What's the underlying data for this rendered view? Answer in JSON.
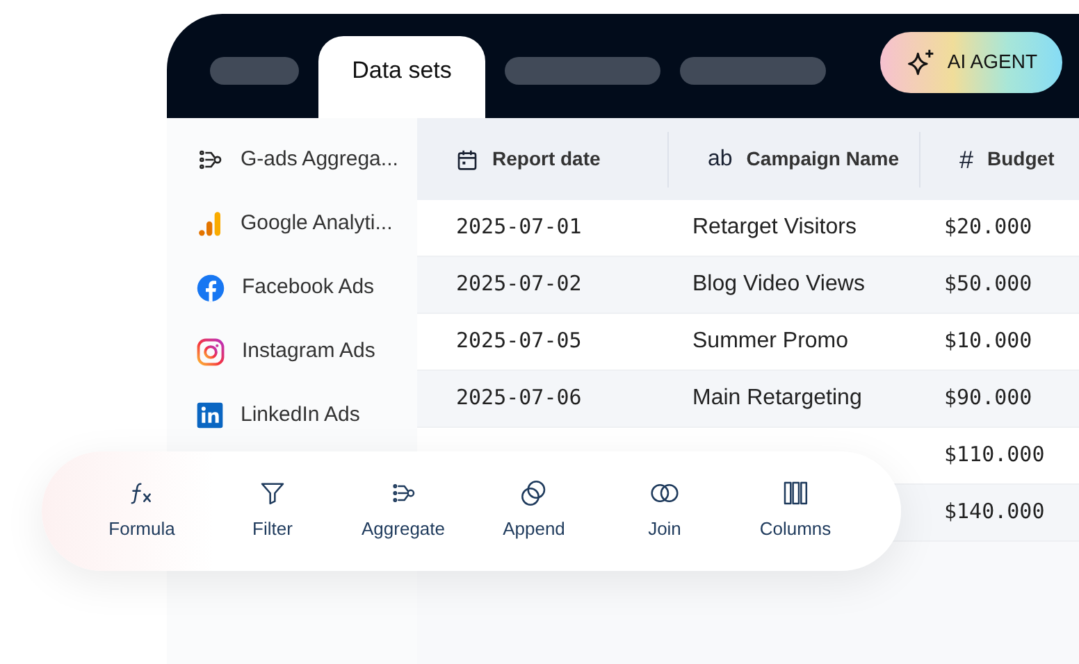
{
  "tabs": [
    {
      "selected": false
    },
    {
      "label": "Data sets",
      "selected": true
    },
    {
      "selected": false
    },
    {
      "selected": false
    }
  ],
  "ai_button": {
    "label": "AI AGENT"
  },
  "sidebar": {
    "items": [
      {
        "kind": "aggregate",
        "label": "G-ads Aggrega..."
      },
      {
        "kind": "analytics",
        "label": "Google Analyti..."
      },
      {
        "kind": "facebook",
        "label": "Facebook Ads"
      },
      {
        "kind": "instagram",
        "label": "Instagram Ads"
      },
      {
        "kind": "linkedin",
        "label": "LinkedIn Ads"
      }
    ]
  },
  "table": {
    "columns": [
      {
        "kind": "date",
        "label": "Report date"
      },
      {
        "kind": "text",
        "type_icon": "ab",
        "label": "Campaign Name"
      },
      {
        "kind": "number",
        "type_icon": "#",
        "label": "Budget"
      }
    ],
    "rows": [
      {
        "report_date": "2025-07-01",
        "campaign_name": "Retarget Visitors",
        "budget": "$20.000"
      },
      {
        "report_date": "2025-07-02",
        "campaign_name": "Blog Video Views",
        "budget": "$50.000"
      },
      {
        "report_date": "2025-07-05",
        "campaign_name": "Summer Promo",
        "budget": "$10.000"
      },
      {
        "report_date": "2025-07-06",
        "campaign_name": "Main Retargeting",
        "budget": "$90.000"
      },
      {
        "budget": "$110.000"
      },
      {
        "budget": "$140.000"
      }
    ]
  },
  "toolbar": {
    "items": [
      {
        "kind": "formula",
        "label": "Formula"
      },
      {
        "kind": "filter",
        "label": "Filter"
      },
      {
        "kind": "aggregate",
        "label": "Aggregate"
      },
      {
        "kind": "append",
        "label": "Append"
      },
      {
        "kind": "join",
        "label": "Join"
      },
      {
        "kind": "columns",
        "label": "Columns"
      }
    ]
  }
}
